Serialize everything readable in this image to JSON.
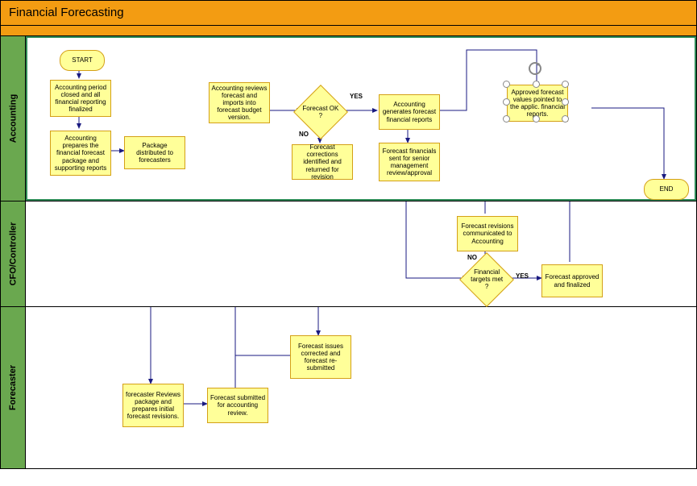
{
  "header": {
    "title": "Financial Forecasting"
  },
  "lanes": {
    "accounting": "Accounting",
    "cfo": "CFO/Controller",
    "forecaster": "Forecaster"
  },
  "nodes": {
    "start": "START",
    "end": "END",
    "period_closed": "Accounting period closed and all financial reporting finalized",
    "prepare_package": "Accounting prepares the financial forecast package and supporting reports",
    "distribute": "Package distributed to forecasters",
    "review_import": "Accounting reviews forecast and imports into forecast budget version.",
    "forecast_ok": "Forecast OK ?",
    "corrections": "Forecast corrections identified and returned for revision",
    "gen_reports": "Accounting generates forecast financial reports",
    "sent_mgmt": "Forecast financials sent for senior management review/approval",
    "approved_values": "Approved forecast values pointed to the applic. financial reports.",
    "revisions_comm": "Forecast revisions communicated to Accounting",
    "targets_met": "Financial targets met ?",
    "approved_final": "Forecast approved and finalized",
    "forecaster_reviews": "forecaster Reviews package and prepares initial forecast revisions.",
    "submitted": "Forecast submitted for accounting review.",
    "issues_corrected": "Forecast issues corrected and forecast re-submitted"
  },
  "labels": {
    "yes": "YES",
    "no": "NO"
  }
}
